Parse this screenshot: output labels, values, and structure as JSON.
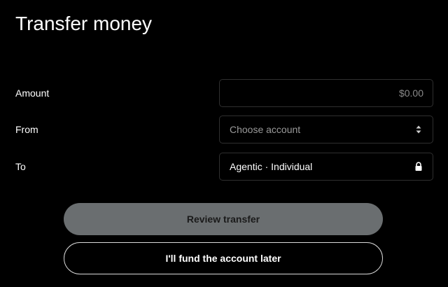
{
  "header": {
    "title": "Transfer money"
  },
  "form": {
    "amount": {
      "label": "Amount",
      "placeholder": "$0.00",
      "value": ""
    },
    "from": {
      "label": "From",
      "placeholder": "Choose account",
      "icon": "sort-arrows-icon"
    },
    "to": {
      "label": "To",
      "value": "Agentic · Individual",
      "icon": "lock-icon"
    }
  },
  "actions": {
    "review_label": "Review transfer",
    "fund_later_label": "I'll fund the account later"
  },
  "colors": {
    "background": "#000000",
    "primary_button": "#6a6e70",
    "field_border": "#2f2f2f"
  }
}
